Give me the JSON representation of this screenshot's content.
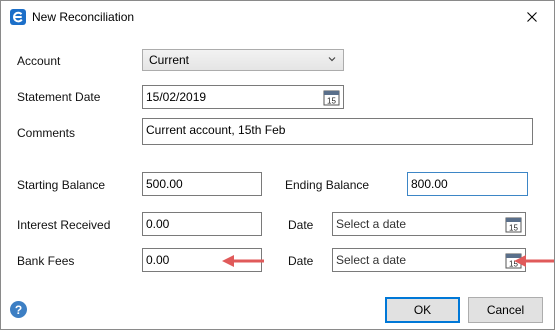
{
  "window": {
    "title": "New Reconciliation",
    "app_icon": "app-logo-icon",
    "close_icon": "close-icon"
  },
  "form": {
    "account": {
      "label": "Account",
      "value": "Current"
    },
    "statement_date": {
      "label": "Statement Date",
      "value": "15/02/2019",
      "calendar_day": "15"
    },
    "comments": {
      "label": "Comments",
      "value": "Current account, 15th Feb"
    },
    "starting_balance": {
      "label": "Starting Balance",
      "value": "500.00"
    },
    "ending_balance": {
      "label": "Ending Balance",
      "value": "800.00"
    },
    "interest_received": {
      "label": "Interest Received",
      "value": "0.00"
    },
    "interest_date": {
      "label": "Date",
      "placeholder": "Select a date",
      "calendar_day": "15"
    },
    "bank_fees": {
      "label": "Bank Fees",
      "value": "0.00"
    },
    "bank_fees_date": {
      "label": "Date",
      "placeholder": "Select a date",
      "calendar_day": "15"
    }
  },
  "buttons": {
    "ok": "OK",
    "cancel": "Cancel",
    "help": "?"
  },
  "colors": {
    "accent": "#0078d7",
    "annotation_arrow": "#e05a5a",
    "help_icon": "#3d7fc4"
  }
}
